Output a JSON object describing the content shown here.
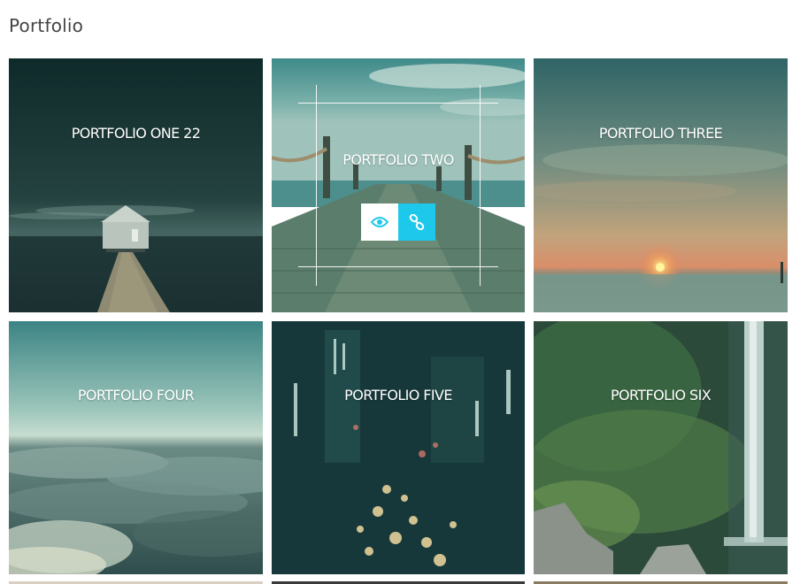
{
  "page": {
    "title": "Portfolio"
  },
  "portfolio": {
    "items": [
      {
        "label": "PORTFOLIO ONE 22"
      },
      {
        "label": "PORTFOLIO TWO"
      },
      {
        "label": "PORTFOLIO THREE"
      },
      {
        "label": "PORTFOLIO FOUR"
      },
      {
        "label": "PORTFOLIO FIVE"
      },
      {
        "label": "PORTFOLIO SIX"
      }
    ],
    "hover_actions": [
      {
        "icon": "eye-icon"
      },
      {
        "icon": "link-icon"
      }
    ]
  },
  "colors": {
    "accent": "#1dc8ea",
    "overlay_tint": "#1a5a55",
    "title_text": "#444444"
  }
}
